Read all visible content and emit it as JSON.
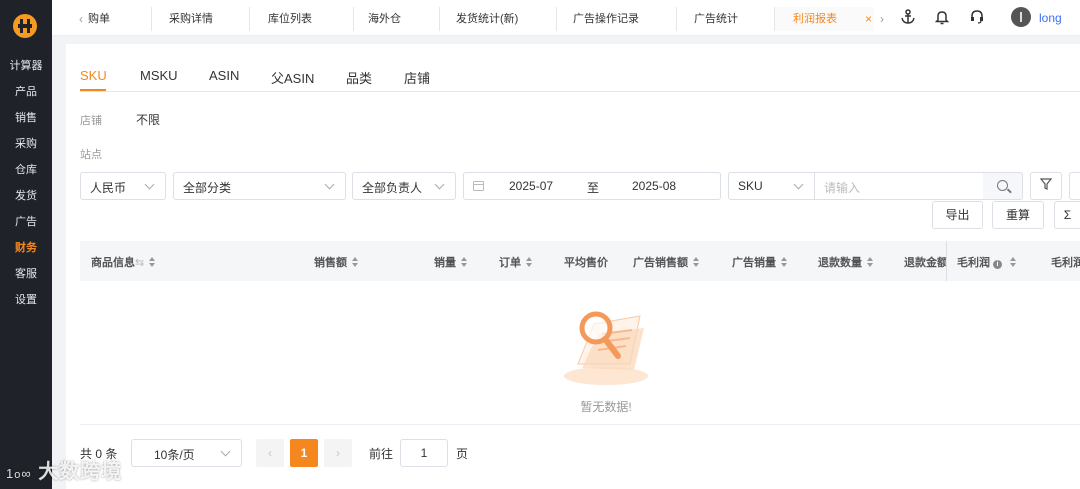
{
  "sidebar": {
    "items": [
      {
        "label": "计算器"
      },
      {
        "label": "产品"
      },
      {
        "label": "销售"
      },
      {
        "label": "采购"
      },
      {
        "label": "仓库"
      },
      {
        "label": "发货"
      },
      {
        "label": "广告"
      },
      {
        "label": "财务"
      },
      {
        "label": "客服"
      },
      {
        "label": "设置"
      }
    ],
    "active_index": 7
  },
  "topbar": {
    "tabs": [
      {
        "label": "购单"
      },
      {
        "label": "采购详情"
      },
      {
        "label": "库位列表"
      },
      {
        "label": "海外仓"
      },
      {
        "label": "发货统计(新)"
      },
      {
        "label": "广告操作记录"
      },
      {
        "label": "广告统计"
      },
      {
        "label": "利润报表"
      }
    ],
    "active_tab": "利润报表",
    "close_glyph": "×",
    "prev_glyph": "‹",
    "next_glyph": "›",
    "icons": [
      "anchor-icon",
      "bell-icon",
      "headset-icon"
    ],
    "username": "long"
  },
  "subtabs": [
    {
      "label": "SKU"
    },
    {
      "label": "MSKU"
    },
    {
      "label": "ASIN"
    },
    {
      "label": "父ASIN"
    },
    {
      "label": "品类"
    },
    {
      "label": "店铺"
    }
  ],
  "filters": {
    "shop_label": "店铺",
    "shop_value": "不限",
    "site_label": "站点",
    "currency": "人民币",
    "category": "全部分类",
    "owner": "全部负责人",
    "date_start": "2025-07",
    "date_sep": "至",
    "date_end": "2025-08",
    "search_field": "SKU",
    "search_placeholder": "请输入"
  },
  "actions": {
    "export_label": "导出",
    "reset_label": "重算",
    "sum_glyph": "Σ"
  },
  "table": {
    "columns": [
      {
        "label": "商品信息"
      },
      {
        "label": "销售额"
      },
      {
        "label": "销量"
      },
      {
        "label": "订单"
      },
      {
        "label": "平均售价"
      },
      {
        "label": "广告销售额"
      },
      {
        "label": "广告销量"
      },
      {
        "label": "退款数量"
      },
      {
        "label": "退款金额"
      },
      {
        "label": "毛利润"
      },
      {
        "label": "毛利润"
      }
    ],
    "empty_text": "暂无数据!"
  },
  "pagination": {
    "total_text": "共 0 条",
    "page_size": "10条/页",
    "current_page": "1",
    "prev_glyph": "‹",
    "next_glyph": "›",
    "goto_label": "前往",
    "goto_value": "1",
    "page_unit": "页"
  },
  "watermark": "大数跨境",
  "colors": {
    "accent": "#f5871f",
    "sidebar_bg": "#1f2329",
    "link": "#3a6ff7"
  }
}
